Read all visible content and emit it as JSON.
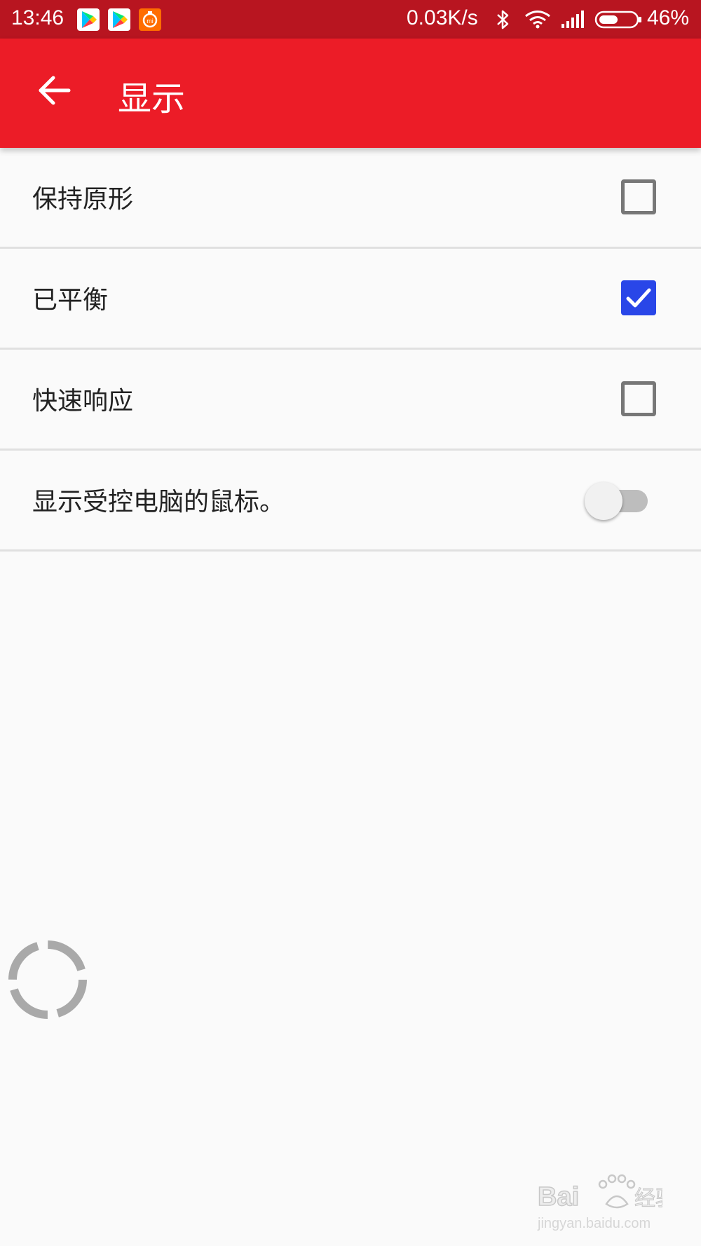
{
  "status_bar": {
    "time": "13:46",
    "network_speed": "0.03K/s",
    "battery_percent": "46%",
    "icons": [
      "google-play-icon",
      "google-play-icon",
      "mi-icon",
      "bluetooth-icon",
      "wifi-icon",
      "signal-icon",
      "battery-icon"
    ]
  },
  "app_bar": {
    "title": "显示",
    "back_icon": "arrow-left-icon",
    "color": "#ec1c27"
  },
  "settings": [
    {
      "label": "保持原形",
      "control": "checkbox",
      "checked": false
    },
    {
      "label": "已平衡",
      "control": "checkbox",
      "checked": true
    },
    {
      "label": "快速响应",
      "control": "checkbox",
      "checked": false
    },
    {
      "label": "显示受控电脑的鼠标。",
      "control": "switch",
      "on": false
    }
  ],
  "colors": {
    "status_bar": "#b81520",
    "accent": "#2946e8",
    "background": "#fafafa"
  },
  "spinner_icon": "loading-spinner-icon",
  "watermark_icon": "baidu-jingyan-watermark"
}
